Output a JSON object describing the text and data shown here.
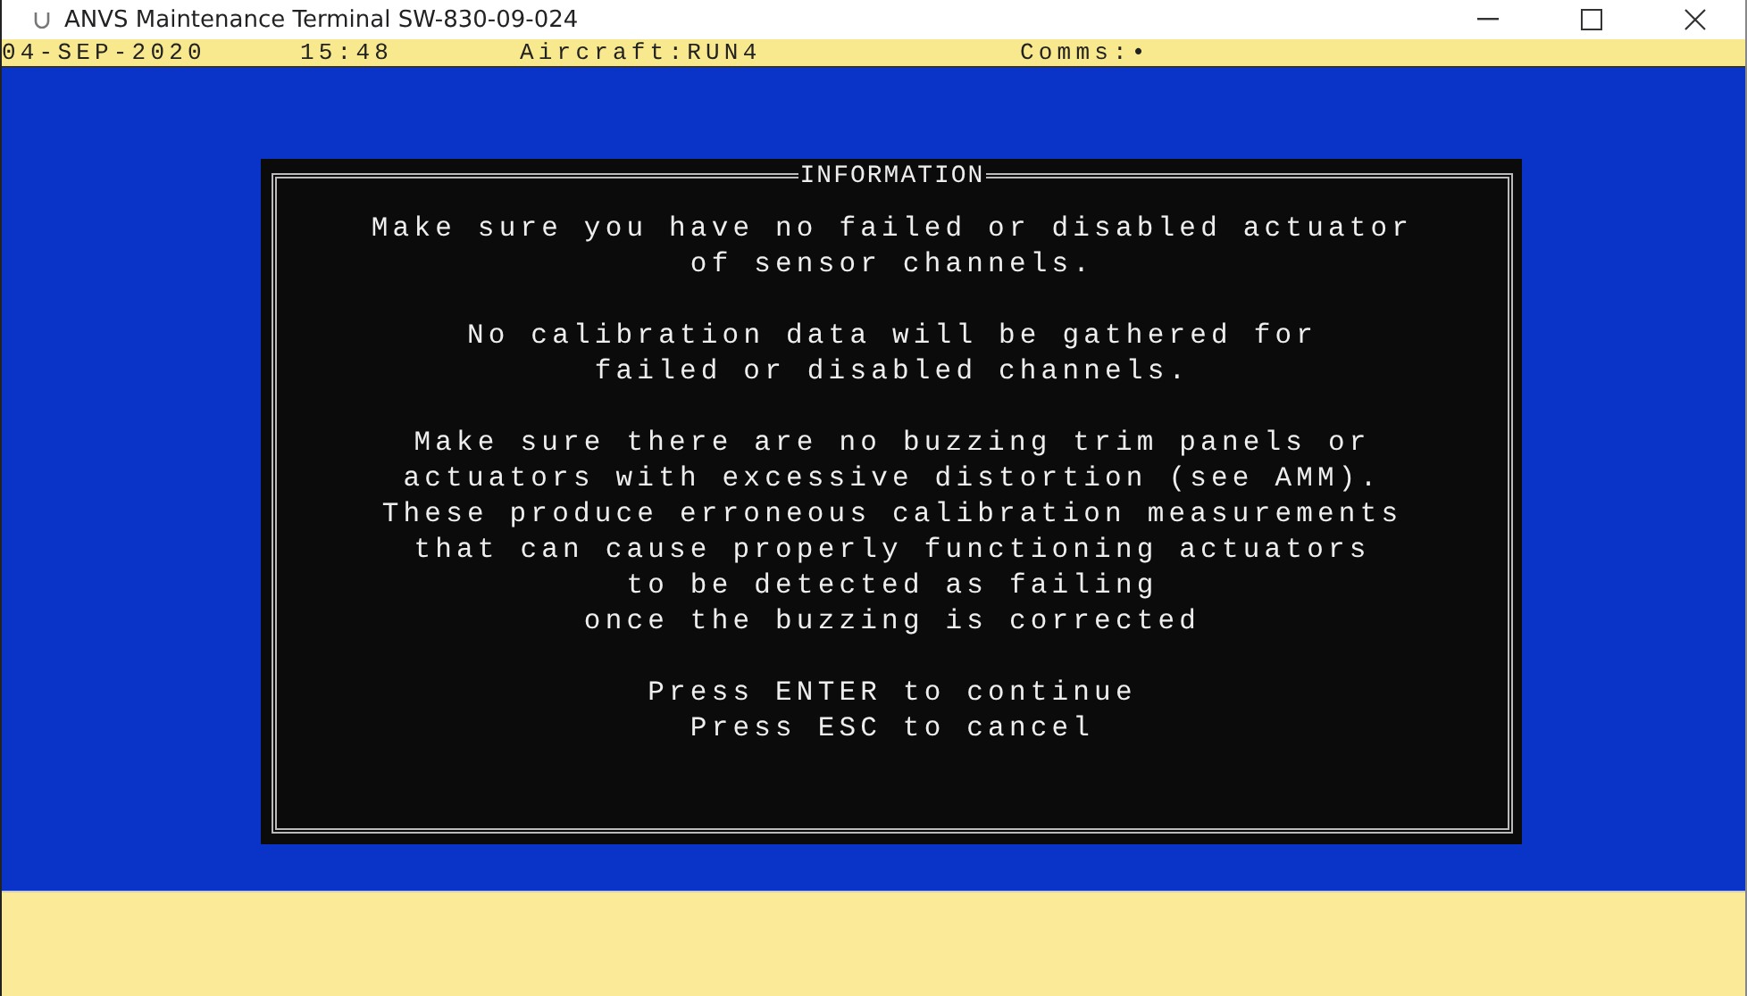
{
  "window": {
    "title": "ANVS Maintenance Terminal SW-830-09-024"
  },
  "status_line": {
    "date": "04-SEP-2020",
    "time": "15:48",
    "aircraft": "Aircraft:RUN4",
    "comms": "Comms:•"
  },
  "dialog": {
    "title": "INFORMATION",
    "paragraphs": [
      {
        "lines": [
          "Make sure you have no failed or disabled actuator",
          "of sensor channels."
        ]
      },
      {
        "lines": [
          "No calibration data will be gathered for",
          "failed or disabled channels."
        ]
      },
      {
        "lines": [
          "Make sure there are no buzzing trim panels or",
          "actuators with excessive distortion (see AMM).",
          "These produce erroneous calibration measurements",
          "that can cause properly functioning actuators",
          "to be detected as failing",
          "once the buzzing is corrected"
        ]
      },
      {
        "lines": [
          "Press ENTER to continue",
          "Press ESC to cancel"
        ]
      }
    ]
  }
}
